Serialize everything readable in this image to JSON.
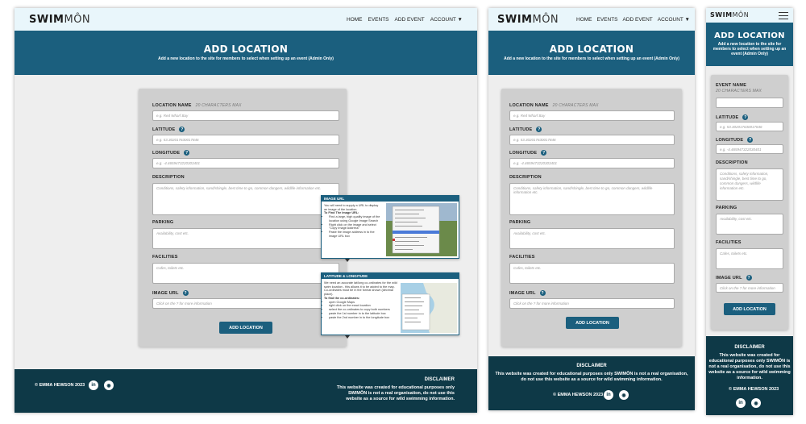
{
  "brand": {
    "name_bold": "SWIM",
    "name_light": "MÔN"
  },
  "nav": {
    "home": "HOME",
    "events": "EVENTS",
    "add_event": "ADD EVENT",
    "account": "ACCOUNT ▼"
  },
  "hero": {
    "title": "ADD LOCATION",
    "subtitle": "Add a new location to the site for members to select when setting up an event (Admin Only)"
  },
  "form": {
    "name_label": "LOCATION NAME",
    "name_hint": "20 CHARACTERS MAX",
    "name_placeholder": "e.g. Red Wharf Bay",
    "event_name_label": "EVENT NAME",
    "latitude_label": "LATITUDE",
    "latitude_placeholder": "e.g. 53.302017630017846",
    "latitude_placeholder_short": "e.g. 53.302017630017846",
    "longitude_label": "LONGITUDE",
    "longitude_placeholder": "e.g. -4.4659473220303401",
    "longitude_placeholder_short": "e.g. -4.465947322030401",
    "description_label": "DESCRIPTION",
    "description_placeholder": "Conditions, safety information, sand/shingle, best time to go, common dangers, wildlife information etc.",
    "parking_label": "PARKING",
    "parking_placeholder": "Availability, cost etc.",
    "facilities_label": "FACILITIES",
    "facilities_placeholder": "Cafes, toilets etc.",
    "image_label": "IMAGE URL",
    "image_placeholder": "Click on the ? for more information",
    "submit": "ADD LOCATION"
  },
  "tooltip_image": {
    "title": "IMAGE URL",
    "intro": "You will need to supply a URL to display an image of the location.",
    "howto": "To Find The Image URL:",
    "steps": [
      "Find a large, high quality image of the location using Google Image Search",
      "Right click on the image and select \"Copy Image Address\"",
      "Paste the image address in to the image URL box"
    ]
  },
  "tooltip_latlng": {
    "title": "LATITUDE & LONGITUDE",
    "intro": "We need an accurate lat/long co-ordinates for the wild swim location - this allows it to be added to the map. Co-ordinates must be in the format shown (decimal place).",
    "howto": "To find the co-ordinates:",
    "steps": [
      "open Google Maps",
      "right click on the exact location",
      "select the co-ordinates to copy both numbers",
      "paste the 1st number in to the latitude box",
      "paste the 2nd number in to the longitude box"
    ]
  },
  "footer": {
    "copyright": "© EMMA HEWSON 2023",
    "disclaimer_title": "DISCLAIMER",
    "disclaimer": "This website was created for educational purposes only SWIMÔN is not a real organisation, do not use this website as a source for wild swimming information."
  },
  "social": {
    "linkedin": "in",
    "github": "◉"
  },
  "colors": {
    "primary": "#1b5f7e",
    "footer": "#0e3947",
    "nav": "#e9f6fb",
    "card": "#cfcfcf"
  }
}
